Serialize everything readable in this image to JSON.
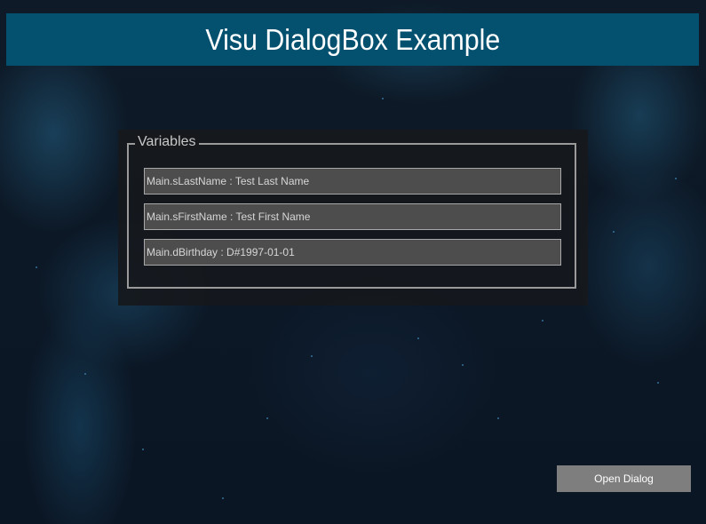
{
  "header": {
    "title": "Visu DialogBox Example"
  },
  "variables_group": {
    "legend": "Variables",
    "fields": [
      {
        "text": "Main.sLastName : Test Last Name"
      },
      {
        "text": "Main.sFirstName : Test First Name"
      },
      {
        "text": "Main.dBirthday : D#1997-01-01"
      }
    ]
  },
  "actions": {
    "open_dialog_label": "Open Dialog"
  },
  "colors": {
    "title_bar": "#03506f",
    "field_background": "#4d4d4d",
    "button_background": "#7e7e7e",
    "page_background": "#0c1826"
  }
}
